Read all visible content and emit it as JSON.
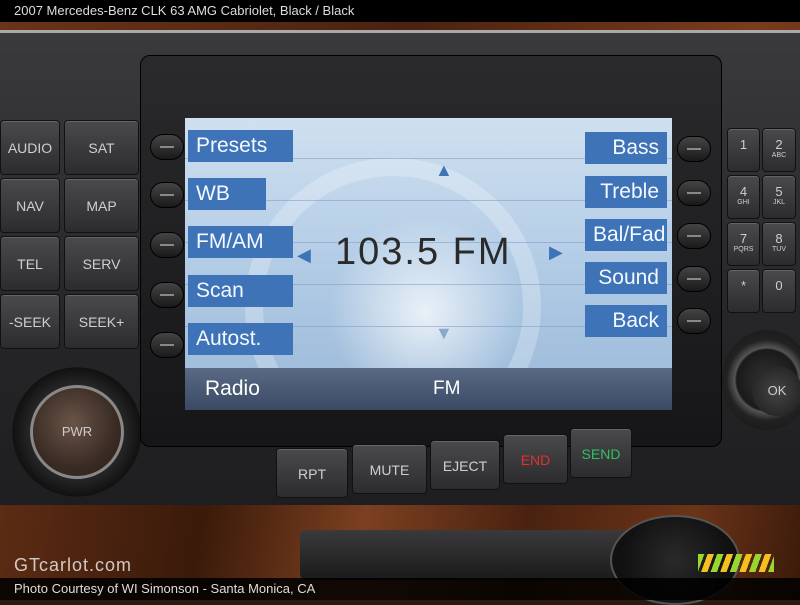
{
  "header": {
    "caption": "2007 Mercedes-Benz CLK 63 AMG Cabriolet,  Black / Black"
  },
  "left_buttons": [
    {
      "label": "AUDIO"
    },
    {
      "label": "SAT"
    },
    {
      "label": "NAV"
    },
    {
      "label": "MAP"
    },
    {
      "label": "TEL"
    },
    {
      "label": "SERV"
    },
    {
      "label": "-SEEK"
    },
    {
      "label": "SEEK+"
    }
  ],
  "power": {
    "label": "PWR"
  },
  "screen": {
    "left_softkeys": [
      "Presets",
      "WB",
      "FM/AM",
      "Scan",
      "Autost."
    ],
    "right_softkeys": [
      "Bass",
      "Treble",
      "Bal/Fad",
      "Sound",
      "Back"
    ],
    "frequency": "103.5 FM",
    "source": "Radio",
    "band": "FM",
    "accent_color": "#3f73b8"
  },
  "bottom_buttons": [
    {
      "label": "RPT",
      "color": "#cfcfcf"
    },
    {
      "label": "MUTE",
      "color": "#cfcfcf"
    },
    {
      "label": "EJECT",
      "color": "#cfcfcf"
    },
    {
      "label": "END",
      "color": "#e03030"
    },
    {
      "label": "SEND",
      "color": "#30c060"
    }
  ],
  "keypad": [
    {
      "num": "1",
      "sub": ""
    },
    {
      "num": "2",
      "sub": "ABC"
    },
    {
      "num": "4",
      "sub": "GHI"
    },
    {
      "num": "5",
      "sub": "JKL"
    },
    {
      "num": "7",
      "sub": "PQRS"
    },
    {
      "num": "8",
      "sub": "TUV"
    },
    {
      "num": "*",
      "sub": ""
    },
    {
      "num": "0",
      "sub": ""
    }
  ],
  "nav_control": {
    "label": "OK"
  },
  "watermark": "GTcarlot.com",
  "credit": "Photo Courtesy of WI Simonson - Santa Monica, CA"
}
